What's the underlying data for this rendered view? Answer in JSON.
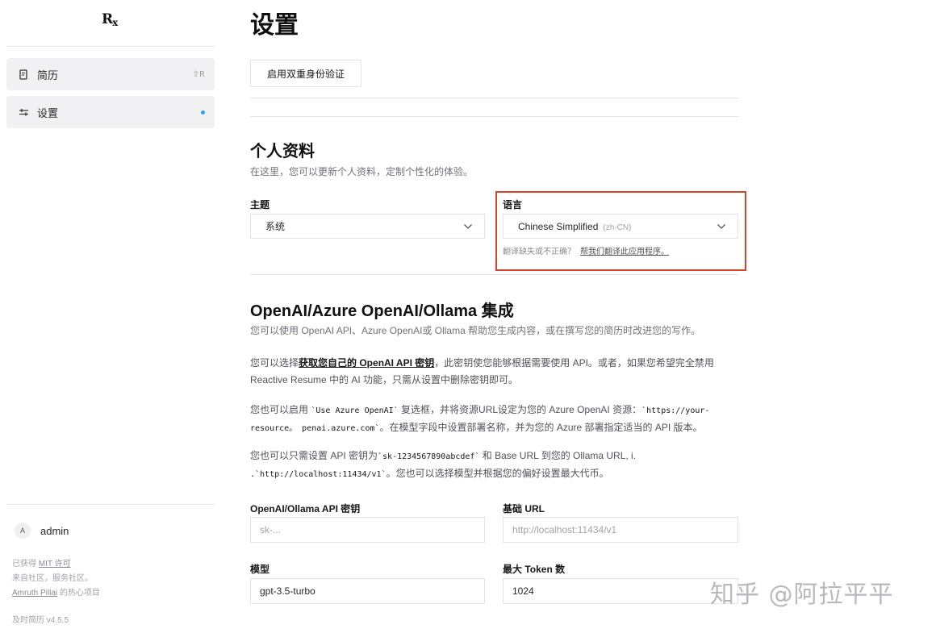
{
  "app": {
    "logo": "R",
    "logo_sub": "x"
  },
  "sidebar": {
    "items": [
      {
        "label": "简历",
        "shortcut": "⇧R"
      },
      {
        "label": "设置"
      }
    ],
    "user": {
      "initial": "A",
      "name": "admin"
    },
    "footer": {
      "line1_prefix": "已获得 ",
      "line1_link": "MIT 许可",
      "line2": "来自社区，服务社区。",
      "line3_link": "Amruth Pillai",
      "line3_suffix": " 的热心项目",
      "version": "及时简历 v4.5.5"
    }
  },
  "main": {
    "title": "设置",
    "two_factor_button": "启用双重身份验证",
    "profile": {
      "title": "个人资料",
      "subtitle": "在这里，您可以更新个人资料，定制个性化的体验。",
      "theme_label": "主题",
      "theme_value": "系统",
      "language_label": "语言",
      "language_value": "Chinese Simplified",
      "language_code": "(zh-CN)",
      "hint_text": "翻译缺失或不正确？",
      "hint_link": "帮我们翻译此应用程序。"
    },
    "openai": {
      "title": "OpenAI/Azure OpenAI/Ollama 集成",
      "subtitle": "您可以使用 OpenAI API、Azure OpenAI或 Ollama 帮助您生成内容，或在撰写您的简历时改进您的写作。",
      "p1_a": "您可以选择",
      "p1_link": "获取您自己的 OpenAI API 密钥",
      "p1_b": "，此密钥使您能够根据需要使用 API。或者，如果您希望完全禁用 Reactive Resume 中的 AI 功能，只需从设置中删除密钥即可。",
      "p2_a": "您也可以启用 ",
      "p2_code1": "`Use Azure OpenAI`",
      "p2_b": " 复选框，并将资源URL设定为您的 Azure OpenAI 资源：",
      "p2_code2": "`https://your-resource。 penai.azure.com`",
      "p2_c": "。在模型字段中设置部署名称，并为您的 Azure 部署指定适当的 API 版本。",
      "p3_a": "您也可以只需设置 API 密钥为",
      "p3_code1": "`sk-1234567890abcdef`",
      "p3_b": " 和 Base URL 到您的 Ollama URL, i.",
      "p3_code2": ".`http://localhost:11434/v1`",
      "p3_c": "。您也可以选择模型并根据您的偏好设置最大代币。",
      "api_key_label": "OpenAI/Ollama API 密钥",
      "api_key_placeholder": "sk-...",
      "base_url_label": "基础 URL",
      "base_url_placeholder": "http://localhost:11434/v1",
      "model_label": "模型",
      "model_value": "gpt-3.5-turbo",
      "max_tokens_label": "最大 Token 数",
      "max_tokens_value": "1024"
    }
  },
  "watermark": "知乎 @阿拉平平"
}
